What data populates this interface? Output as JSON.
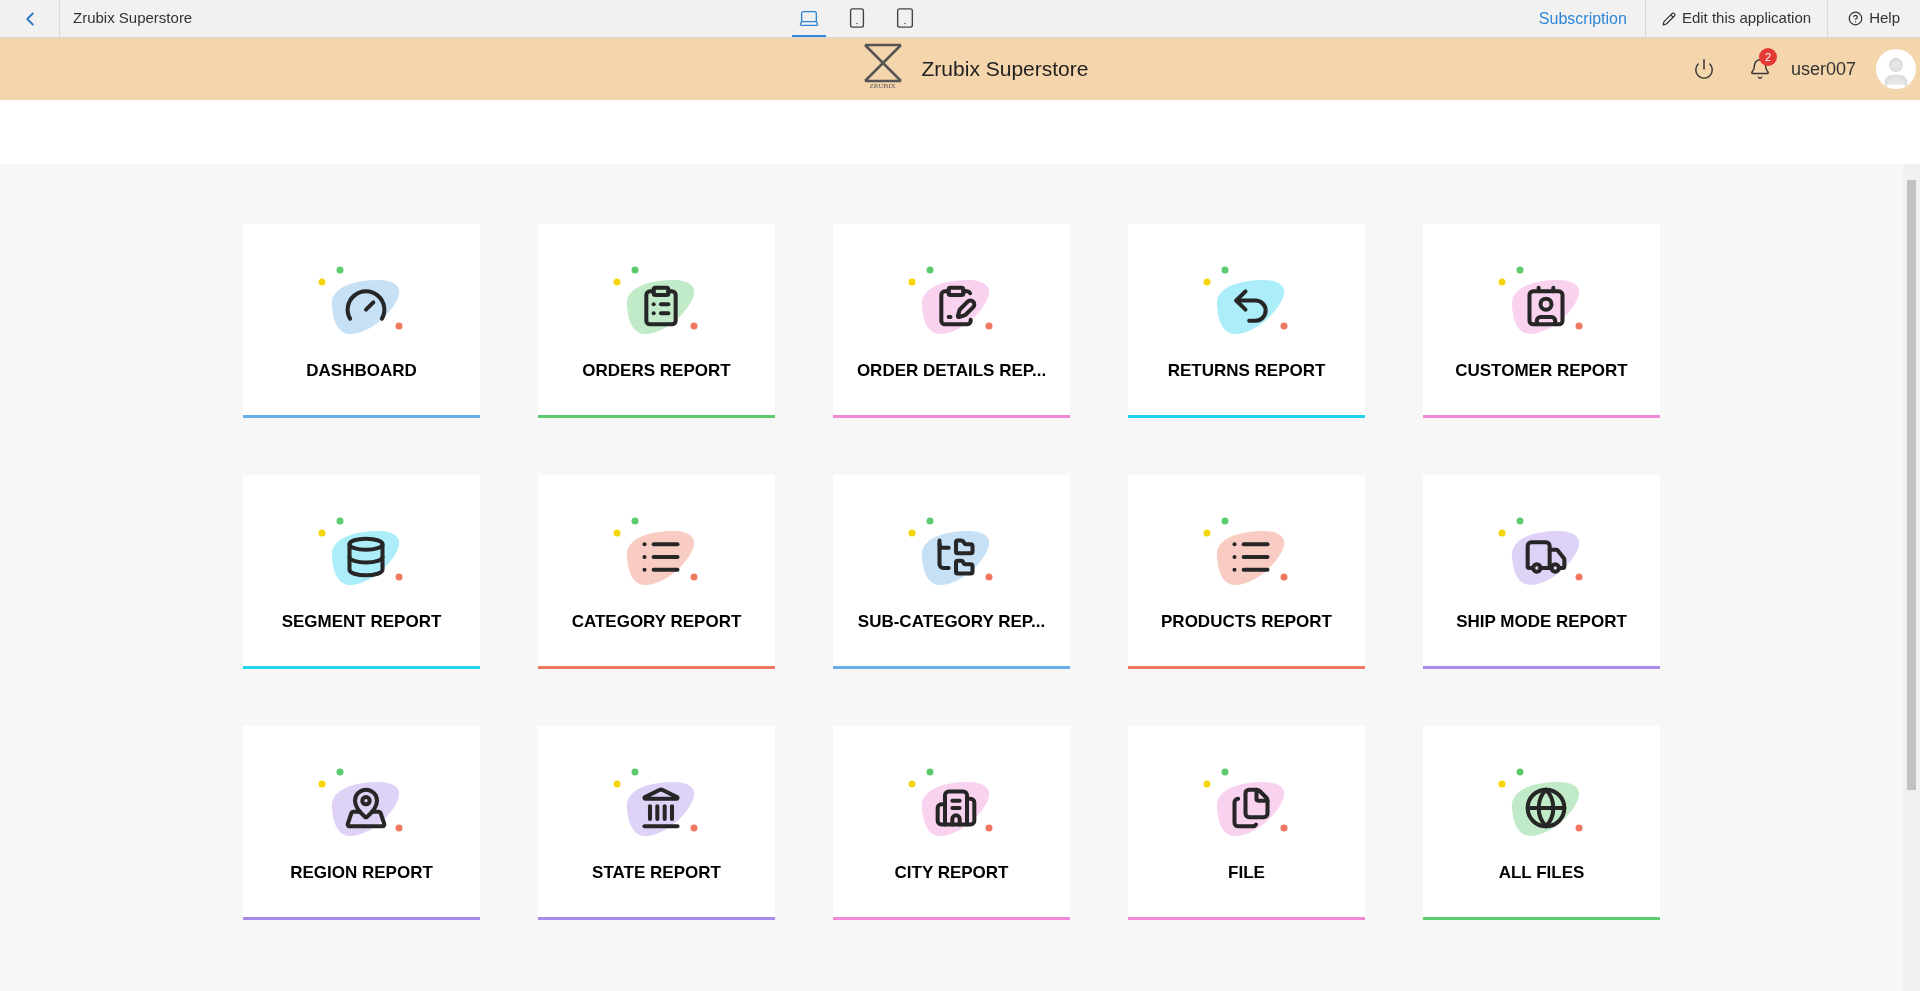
{
  "topbar": {
    "app_name": "Zrubix Superstore",
    "devices": [
      {
        "kind": "laptop",
        "selected": true
      },
      {
        "kind": "phone",
        "selected": false
      },
      {
        "kind": "tablet",
        "selected": false
      }
    ],
    "subscription": "Subscription",
    "edit": "Edit this application",
    "help": "Help"
  },
  "header": {
    "logo_text": "ZRUBIX",
    "title": "Zrubix Superstore",
    "notifications": "2",
    "user": "user007"
  },
  "cards": [
    {
      "label": "DASHBOARD",
      "kind": "gauge",
      "color": "#6aaee8"
    },
    {
      "label": "ORDERS REPORT",
      "kind": "checklist",
      "color": "#5ccb6e"
    },
    {
      "label": "ORDER DETAILS REP...",
      "kind": "clipboard",
      "color": "#f08ad8"
    },
    {
      "label": "RETURNS REPORT",
      "kind": "return",
      "color": "#22d3ee"
    },
    {
      "label": "CUSTOMER REPORT",
      "kind": "contact",
      "color": "#f08ad8"
    },
    {
      "label": "SEGMENT REPORT",
      "kind": "database",
      "color": "#22d3ee"
    },
    {
      "label": "CATEGORY REPORT",
      "kind": "list",
      "color": "#f07860"
    },
    {
      "label": "SUB-CATEGORY REP...",
      "kind": "tree",
      "color": "#6aaee8"
    },
    {
      "label": "PRODUCTS REPORT",
      "kind": "list",
      "color": "#f07860"
    },
    {
      "label": "SHIP MODE REPORT",
      "kind": "truck",
      "color": "#a98ae8"
    },
    {
      "label": "REGION REPORT",
      "kind": "map",
      "color": "#a98ae8"
    },
    {
      "label": "STATE REPORT",
      "kind": "landmark",
      "color": "#a98ae8"
    },
    {
      "label": "CITY REPORT",
      "kind": "buildings",
      "color": "#f08ad8"
    },
    {
      "label": "FILE",
      "kind": "files",
      "color": "#f08ad8"
    },
    {
      "label": "ALL FILES",
      "kind": "globe",
      "color": "#5ccb6e"
    }
  ]
}
